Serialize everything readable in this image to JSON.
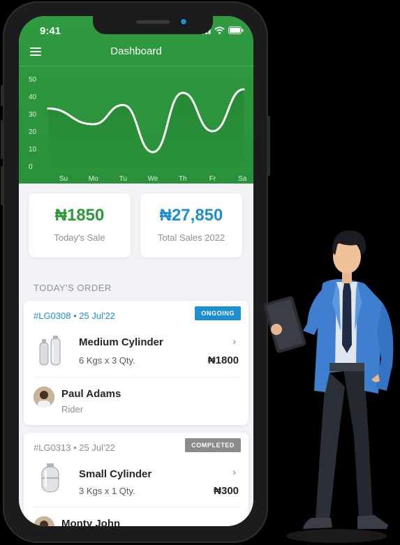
{
  "status": {
    "time": "9:41"
  },
  "appbar": {
    "title": "Dashboard"
  },
  "chart_data": {
    "type": "line",
    "categories": [
      "Su",
      "Mo",
      "Tu",
      "We",
      "Th",
      "Fr",
      "Sa"
    ],
    "values": [
      33,
      24,
      35,
      8,
      42,
      20,
      44
    ],
    "y_ticks": [
      0,
      10,
      20,
      30,
      40,
      50
    ],
    "ylim": [
      0,
      50
    ],
    "grid": false,
    "line_color": "#ffffff"
  },
  "stats": {
    "today": {
      "value": "₦1850",
      "label": "Today's Sale",
      "color": "#2a9a3a"
    },
    "total": {
      "value": "₦27,850",
      "label": "Total Sales 2022",
      "color": "#1b8fd1"
    }
  },
  "section": {
    "title": "TODAY'S ORDER"
  },
  "orders": [
    {
      "id": "#LG0308 • 25 Jul'22",
      "id_color": "#1b8fd1",
      "status": "ONGOING",
      "status_color": "#1b8fd1",
      "product": "Medium Cylinder",
      "qty": "6 Kgs x 3 Qty.",
      "price": "₦1800",
      "person": "Paul Adams",
      "role": "Rider"
    },
    {
      "id": "#LG0313 • 25 Jul'22",
      "id_color": "#8a8f98",
      "status": "COMPLETED",
      "status_color": "#8b8b8b",
      "product": "Small Cylinder",
      "qty": "3 Kgs x 1 Qty.",
      "price": "₦300",
      "person": "Monty John"
    }
  ]
}
